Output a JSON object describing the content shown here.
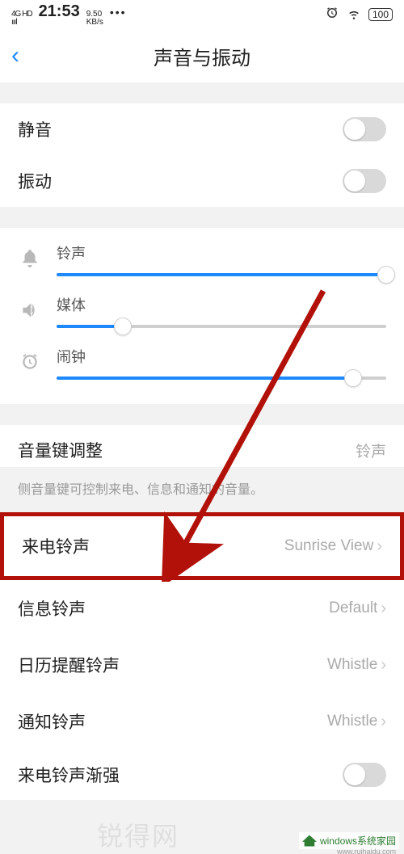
{
  "status": {
    "network": "4G HD",
    "signal_bars": "ıııl",
    "time": "21:53",
    "speed_top": "9.50",
    "speed_bot": "KB/s",
    "dots": "•••",
    "battery_pct": "100"
  },
  "header": {
    "title": "声音与振动"
  },
  "toggles": {
    "mute_label": "静音",
    "vibrate_label": "振动"
  },
  "sliders": {
    "ringtone": {
      "label": "铃声",
      "percent": 100
    },
    "media": {
      "label": "媒体",
      "percent": 20
    },
    "alarm": {
      "label": "闹钟",
      "percent": 90
    }
  },
  "volume_key": {
    "label": "音量键调整",
    "value": "铃声",
    "desc": "侧音量键可控制来电、信息和通知的音量。"
  },
  "links": {
    "incoming": {
      "label": "来电铃声",
      "value": "Sunrise View"
    },
    "message": {
      "label": "信息铃声",
      "value": "Default"
    },
    "calendar": {
      "label": "日历提醒铃声",
      "value": "Whistle"
    },
    "notify": {
      "label": "通知铃声",
      "value": "Whistle"
    },
    "ascending": {
      "label": "来电铃声渐强"
    }
  },
  "watermark": {
    "center": "锐得网",
    "logo_text": "windows系统家园",
    "logo_sub": "www.ruihaidu.com"
  }
}
